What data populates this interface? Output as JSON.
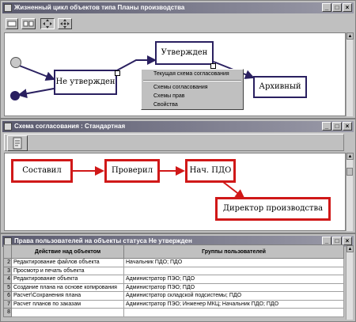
{
  "lifecycle_window": {
    "title": "Жизненный цикл объектов типа Планы производства",
    "toolbar": [
      "select-tool",
      "link-tool",
      "move-tool",
      "zoom-tool"
    ],
    "nodes": {
      "not_approved": "Не утвержден",
      "approved": "Утвержден",
      "archived": "Архивный"
    },
    "context_menu": {
      "items": [
        "Текущая схема согласования",
        "Схемы согласования",
        "Схемы прав",
        "Свойства"
      ]
    }
  },
  "approval_window": {
    "title": "Схема согласования : Стандартная",
    "nodes": {
      "composed": "Составил",
      "checked": "Проверил",
      "head_ppd": "Нач. ПДО",
      "director": "Директор производства"
    }
  },
  "rights_window": {
    "title": "Права пользователей на объекты статуса Не утвержден",
    "columns": [
      "Действие над объектом",
      "Группы пользователей"
    ],
    "rows": [
      {
        "num": "2",
        "action": "Редактирование файлов объекта",
        "groups": "Начальник ПДО; ПДО"
      },
      {
        "num": "3",
        "action": "Просмотр и печать объекта",
        "groups": ""
      },
      {
        "num": "4",
        "action": "Редактирование объекта",
        "groups": "Администратор ПЭО; ПДО"
      },
      {
        "num": "5",
        "action": "Создание плана на основе копирования",
        "groups": "Администратор ПЭО; ПДО"
      },
      {
        "num": "6",
        "action": "Расчет\\Сохранения плана",
        "groups": "Администратор складской подсистемы; ПДО"
      },
      {
        "num": "7",
        "action": "Расчет планов по заказам",
        "groups": "Администратор ПЭО; Инженер МКЦ; Начальник ПДО; ПДО"
      },
      {
        "num": "8",
        "action": "",
        "groups": ""
      }
    ]
  },
  "window_buttons": {
    "min": "_",
    "max": "□",
    "close": "×"
  },
  "colors": {
    "blue_node": "#2a2060",
    "red_node": "#d01818",
    "title_bar": "#6a6a7e"
  }
}
